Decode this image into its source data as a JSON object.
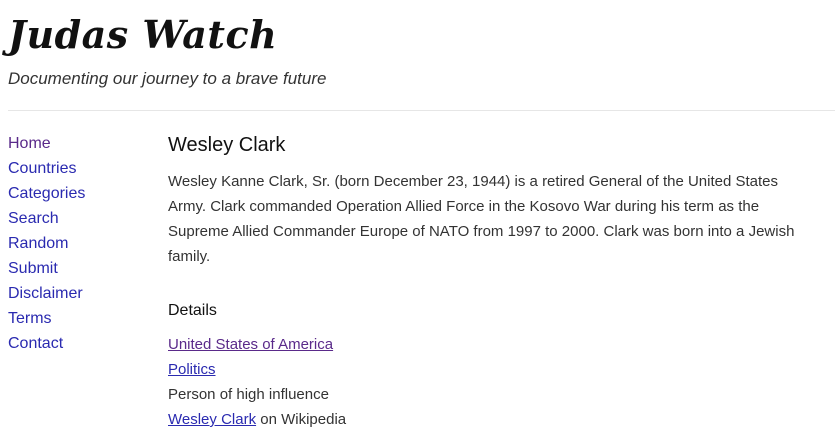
{
  "header": {
    "site_title": "Judas Watch",
    "tagline": "Documenting our journey to a brave future"
  },
  "sidebar": {
    "items": [
      {
        "label": "Home"
      },
      {
        "label": "Countries"
      },
      {
        "label": "Categories"
      },
      {
        "label": "Search"
      },
      {
        "label": "Random"
      },
      {
        "label": "Submit"
      },
      {
        "label": "Disclaimer"
      },
      {
        "label": "Terms"
      },
      {
        "label": "Contact"
      }
    ]
  },
  "main": {
    "title": "Wesley Clark",
    "description": "Wesley Kanne Clark, Sr. (born December 23, 1944) is a retired General of the United States Army. Clark commanded Operation Allied Force in the Kosovo War during his term as the Supreme Allied Commander Europe of NATO from 1997 to 2000. Clark was born into a Jewish family.",
    "details_heading": "Details",
    "details": {
      "country_link": "United States of America",
      "category_link": "Politics",
      "influence_text": "Person of high influence",
      "wikipedia_link": "Wesley Clark",
      "wikipedia_suffix": " on Wikipedia"
    }
  },
  "colors": {
    "link": "#2a2ab0",
    "visited_link": "#5a2a8a",
    "text": "#333333"
  }
}
